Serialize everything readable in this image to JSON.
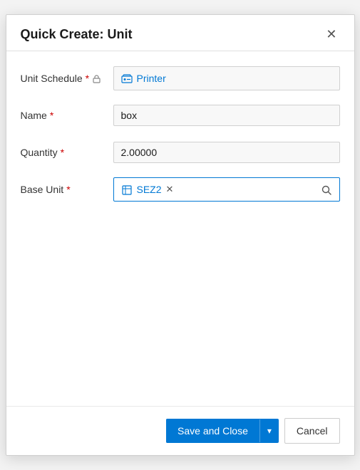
{
  "dialog": {
    "title": "Quick Create: Unit",
    "close_label": "×"
  },
  "form": {
    "unit_schedule": {
      "label": "Unit Schedule",
      "required": true,
      "locked": true,
      "value": "Printer"
    },
    "name": {
      "label": "Name",
      "required": true,
      "value": "box"
    },
    "quantity": {
      "label": "Quantity",
      "required": true,
      "value": "2.00000"
    },
    "base_unit": {
      "label": "Base Unit",
      "required": true,
      "value": "SEZ2"
    }
  },
  "footer": {
    "save_close_label": "Save and Close",
    "cancel_label": "Cancel"
  }
}
